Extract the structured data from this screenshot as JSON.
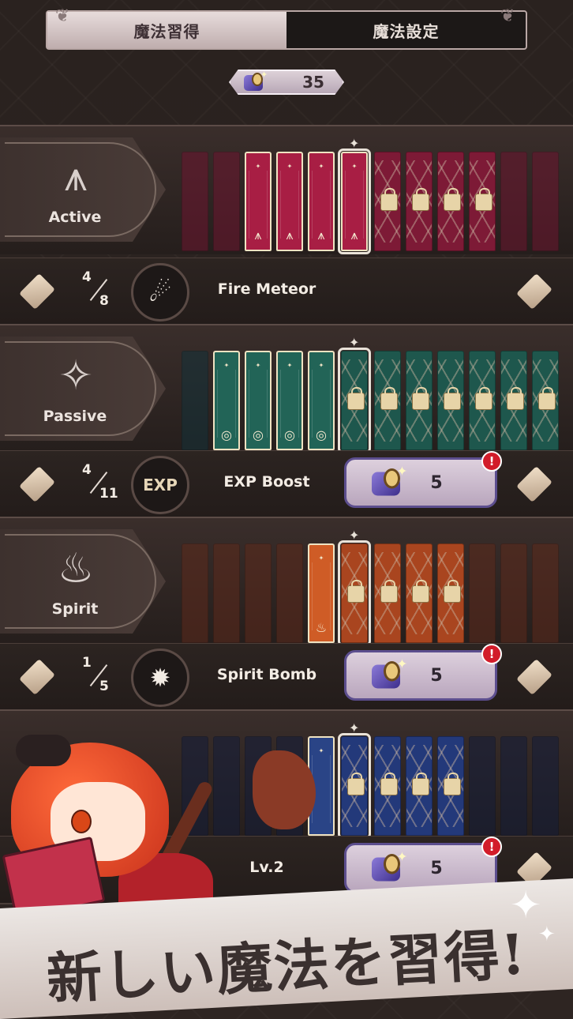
{
  "tabs": {
    "learn": "魔法習得",
    "settings": "魔法設定"
  },
  "currency": {
    "amount": "35",
    "icon": "magic-key-gem-icon"
  },
  "shelves": [
    {
      "name": "Active",
      "icon": "active-magic-icon",
      "color": "#9a1d3d",
      "count": "4",
      "total": "8",
      "skill": "Fire Meteor",
      "skill_icon": "fire-meteor-icon",
      "cost": null
    },
    {
      "name": "Passive",
      "icon": "passive-magic-icon",
      "color": "#1f5a50",
      "count": "4",
      "total": "11",
      "skill": "EXP Boost",
      "skill_icon": "exp-boost-icon",
      "cost": "5",
      "alert": "!"
    },
    {
      "name": "Spirit",
      "icon": "spirit-flame-icon",
      "color": "#b24c25",
      "count": "1",
      "total": "5",
      "skill": "Spirit Bomb",
      "skill_icon": "spirit-bomb-icon",
      "cost": "5",
      "alert": "!"
    },
    {
      "name": "",
      "icon": "",
      "color": "#243a6e",
      "count": "",
      "total": "",
      "skill": "Lv.2",
      "skill_icon": "",
      "cost": "5",
      "alert": "!"
    }
  ],
  "banner": {
    "text": "新しい魔法を習得!"
  }
}
